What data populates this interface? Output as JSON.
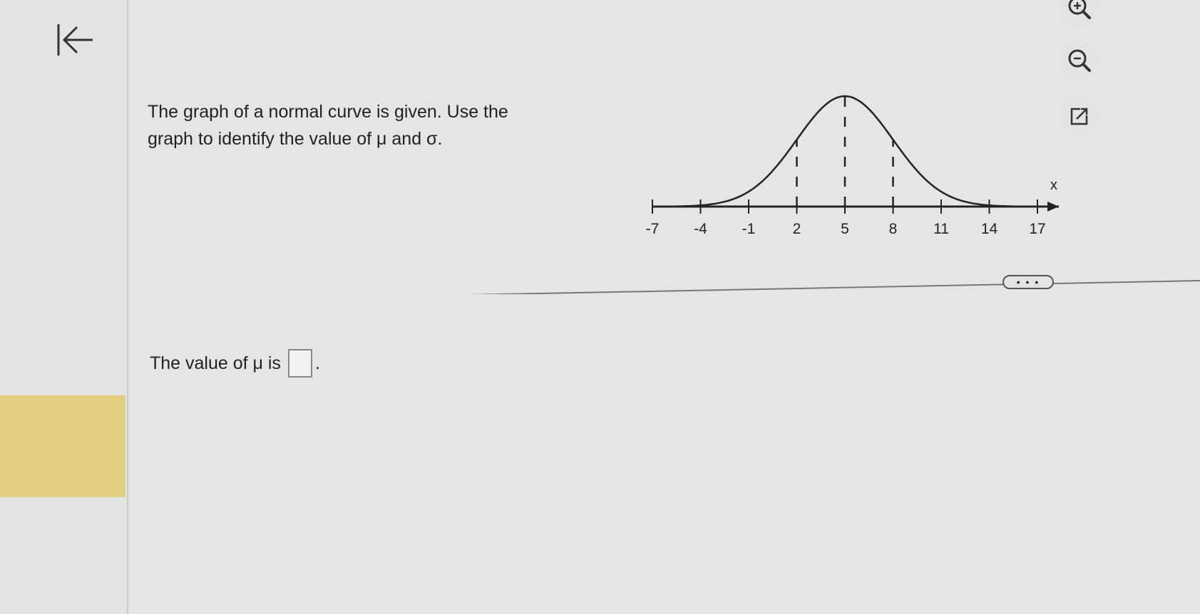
{
  "question": {
    "line1": "The graph of a normal curve is given. Use the",
    "line2": "graph to identify the value of μ and σ."
  },
  "answer": {
    "prefix": "The value of μ is",
    "suffix": "."
  },
  "more_button": {
    "label": "• • •"
  },
  "chart_data": {
    "type": "line",
    "title": "",
    "xlabel": "x",
    "ylabel": "",
    "xlim": [
      -7,
      17
    ],
    "tick_labels": [
      "-7",
      "-4",
      "-1",
      "2",
      "5",
      "8",
      "11",
      "14",
      "17"
    ],
    "ticks": [
      -7,
      -4,
      -1,
      2,
      5,
      8,
      11,
      14,
      17
    ],
    "curve": {
      "kind": "normal",
      "mean": 5,
      "sd": 3
    },
    "dashed_lines_at": [
      2,
      5,
      8
    ],
    "grid": false
  },
  "colors": {
    "background": "#e4e6e3",
    "left_highlight": "#e3cf82",
    "ink": "#222222"
  }
}
